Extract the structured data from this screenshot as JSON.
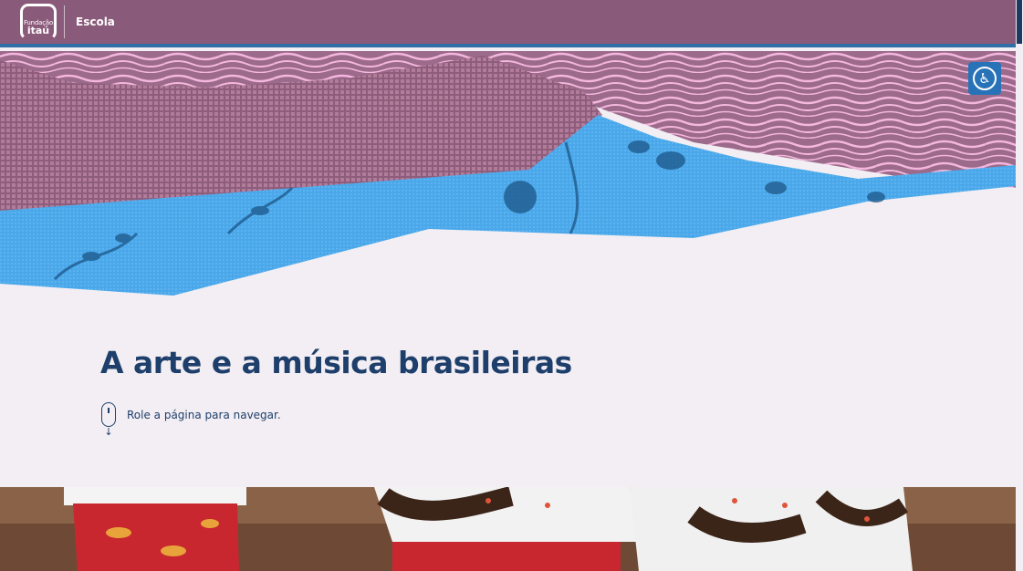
{
  "header": {
    "logo_line1": "Fundação",
    "logo_line2": "itaú",
    "brand_name": "Escola"
  },
  "hero": {
    "title": "A arte e a música brasileiras",
    "scroll_hint": "Role a página para navegar.",
    "mouse_icon": "mouse-scroll-icon",
    "arrow_icon": "arrow-down-icon",
    "arrow_glyph": "↓"
  },
  "accessibility": {
    "icon": "accessibility-icon",
    "glyph": "♿"
  },
  "colors": {
    "header_bg": "#8a5a7a",
    "header_border": "#2f6ea6",
    "page_bg": "#f2eef3",
    "title": "#1e3f6b",
    "fabric_pink": "#f4b7dd",
    "fabric_mauve": "#a06a8a",
    "fabric_blue": "#4da9ea",
    "a11y_bg": "#2873b8"
  }
}
